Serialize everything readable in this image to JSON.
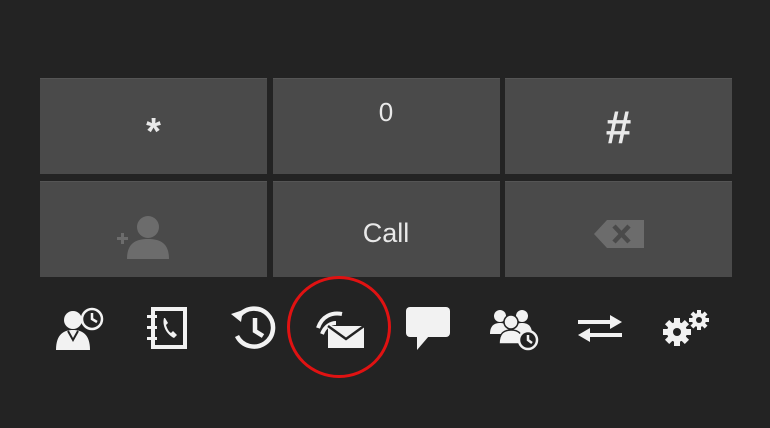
{
  "keypad": {
    "keys": [
      {
        "label": "*",
        "name": "star"
      },
      {
        "label": "0",
        "name": "zero"
      },
      {
        "label": "#",
        "name": "hash"
      },
      {
        "label": "",
        "name": "add-contact",
        "icon": "add-contact-icon",
        "enabled": false
      },
      {
        "label": "Call",
        "name": "call"
      },
      {
        "label": "",
        "name": "backspace",
        "icon": "backspace-icon",
        "enabled": false
      }
    ]
  },
  "toolbar": {
    "items": [
      {
        "icon": "presence-status-icon"
      },
      {
        "icon": "contacts-book-icon"
      },
      {
        "icon": "call-history-icon"
      },
      {
        "icon": "voicemail-icon",
        "highlighted": true
      },
      {
        "icon": "chat-bubble-icon"
      },
      {
        "icon": "conference-icon"
      },
      {
        "icon": "transfer-arrows-icon"
      },
      {
        "icon": "settings-gears-icon"
      }
    ]
  },
  "colors": {
    "background": "#232323",
    "key": "#4a4a4a",
    "text": "#e9e9e9",
    "dim_icon": "#6c6c6c",
    "highlight": "#e01212"
  }
}
